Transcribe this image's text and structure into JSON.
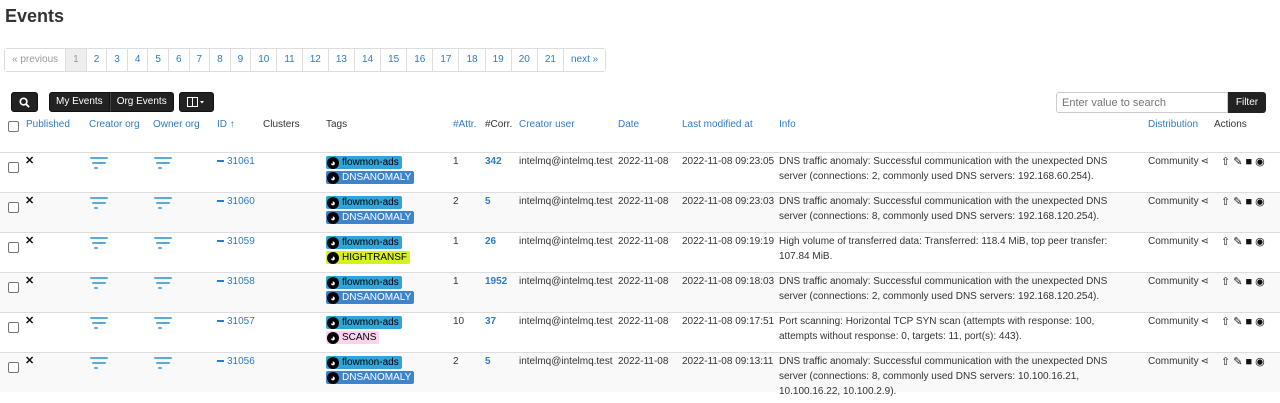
{
  "page": {
    "title": "Events"
  },
  "pagination": [
    "« previous",
    "1",
    "2",
    "3",
    "4",
    "5",
    "6",
    "7",
    "8",
    "9",
    "10",
    "11",
    "12",
    "13",
    "14",
    "15",
    "16",
    "17",
    "18",
    "19",
    "20",
    "21",
    "next »"
  ],
  "toolbar": {
    "my_events": "My Events",
    "org_events": "Org Events"
  },
  "search": {
    "placeholder": "Enter value to search",
    "filter": "Filter"
  },
  "columns": {
    "published": "Published",
    "creator_org": "Creator org",
    "owner_org": "Owner org",
    "id": "ID ↑",
    "clusters": "Clusters",
    "tags": "Tags",
    "attr": "#Attr.",
    "corr": "#Corr.",
    "creator_user": "Creator user",
    "date": "Date",
    "last_modified": "Last modified at",
    "info": "Info",
    "distribution": "Distribution",
    "actions": "Actions"
  },
  "rows": [
    {
      "id": "31061",
      "tag1": "flowmon-ads",
      "tag2": "DNSANOMALY",
      "attr": "1",
      "corr": "342",
      "user": "intelmq@intelmq.test",
      "date": "2022-11-08",
      "modified": "2022-11-08 09:23:05",
      "info": "DNS traffic anomaly: Successful communication with the unexpected DNS server (connections: 2, commonly used DNS servers: 192.168.60.254).",
      "distribution": "Community"
    },
    {
      "id": "31060",
      "tag1": "flowmon-ads",
      "tag2": "DNSANOMALY",
      "attr": "2",
      "corr": "5",
      "user": "intelmq@intelmq.test",
      "date": "2022-11-08",
      "modified": "2022-11-08 09:23:03",
      "info": "DNS traffic anomaly: Successful communication with the unexpected DNS server (connections: 8, commonly used DNS servers: 192.168.120.254).",
      "distribution": "Community"
    },
    {
      "id": "31059",
      "tag1": "flowmon-ads",
      "tag2": "HIGHTRANSF",
      "attr": "1",
      "corr": "26",
      "user": "intelmq@intelmq.test",
      "date": "2022-11-08",
      "modified": "2022-11-08 09:19:19",
      "info": "High volume of transferred data: Transferred: 118.4 MiB, top peer transfer: 107.84 MiB.",
      "distribution": "Community"
    },
    {
      "id": "31058",
      "tag1": "flowmon-ads",
      "tag2": "DNSANOMALY",
      "attr": "1",
      "corr": "1952",
      "user": "intelmq@intelmq.test",
      "date": "2022-11-08",
      "modified": "2022-11-08 09:18:03",
      "info": "DNS traffic anomaly: Successful communication with the unexpected DNS server (connections: 2, commonly used DNS servers: 192.168.120.254).",
      "distribution": "Community"
    },
    {
      "id": "31057",
      "tag1": "flowmon-ads",
      "tag2": "SCANS",
      "attr": "10",
      "corr": "37",
      "user": "intelmq@intelmq.test",
      "date": "2022-11-08",
      "modified": "2022-11-08 09:17:51",
      "info": "Port scanning: Horizontal TCP SYN scan (attempts with response: 100, attempts without response: 0, targets: 11, port(s): 443).",
      "distribution": "Community"
    },
    {
      "id": "31056",
      "tag1": "flowmon-ads",
      "tag2": "DNSANOMALY",
      "attr": "2",
      "corr": "5",
      "user": "intelmq@intelmq.test",
      "date": "2022-11-08",
      "modified": "2022-11-08 09:13:11",
      "info": "DNS traffic anomaly: Successful communication with the unexpected DNS server (connections: 8, commonly used DNS servers: 10.100.16.21, 10.100.16.22, 10.100.2.9).",
      "distribution": "Community"
    }
  ],
  "colors": {
    "link": "#2f7cc1",
    "tag_flowmon": "#30a5d6",
    "tag_DNSANOMALY": "#3e84cc",
    "tag_HIGHTRANSF": "#d5f21b",
    "tag_SCANS": "#f9d3ec"
  },
  "icons": {
    "published": "x-mark-icon",
    "org": "org-logo-icon",
    "id_prefix": "minus-icon",
    "distribution": "share-icon",
    "actions": [
      "publish-icon",
      "edit-icon",
      "delete-icon",
      "view-icon"
    ]
  }
}
